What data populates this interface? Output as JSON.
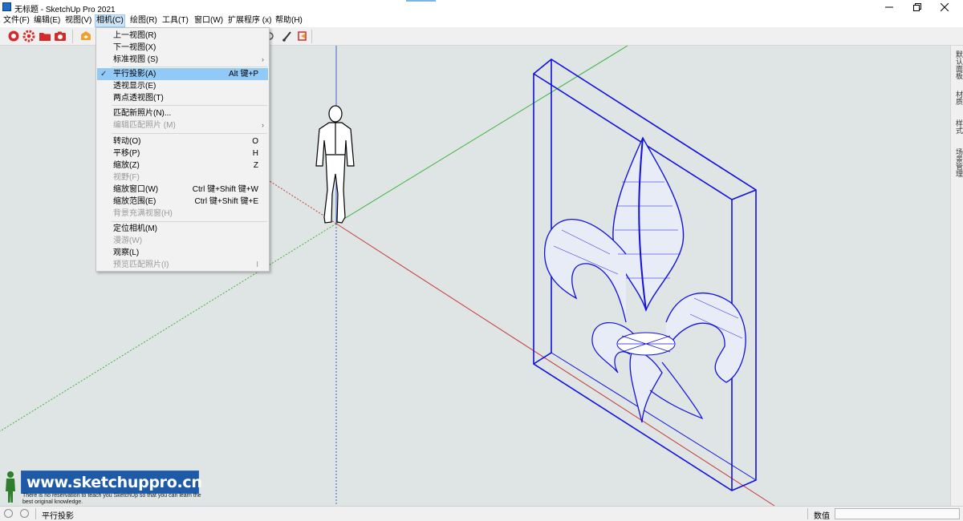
{
  "window": {
    "title": "无标题 - SketchUp Pro 2021"
  },
  "menubar": {
    "items": [
      {
        "label": "文件(F)"
      },
      {
        "label": "编辑(E)"
      },
      {
        "label": "视图(V)"
      },
      {
        "label": "相机(C)"
      },
      {
        "label": "绘图(R)"
      },
      {
        "label": "工具(T)"
      },
      {
        "label": "窗口(W)"
      },
      {
        "label": "扩展程序 (x)"
      },
      {
        "label": "帮助(H)"
      }
    ]
  },
  "camera_menu": {
    "items": [
      {
        "label": "上一视图(R)",
        "shortcut": ""
      },
      {
        "label": "下一视图(X)",
        "shortcut": ""
      },
      {
        "label": "标准视图 (S)",
        "shortcut": ""
      },
      {
        "label": "平行投影(A)",
        "shortcut": "Alt 键+P"
      },
      {
        "label": "透视显示(E)",
        "shortcut": ""
      },
      {
        "label": "两点透视图(T)",
        "shortcut": ""
      },
      {
        "label": "匹配新照片(N)...",
        "shortcut": ""
      },
      {
        "label": "编辑匹配照片 (M)",
        "shortcut": ""
      },
      {
        "label": "转动(O)",
        "shortcut": "O"
      },
      {
        "label": "平移(P)",
        "shortcut": "H"
      },
      {
        "label": "缩放(Z)",
        "shortcut": "Z"
      },
      {
        "label": "视野(F)",
        "shortcut": ""
      },
      {
        "label": "缩放窗口(W)",
        "shortcut": "Ctrl 键+Shift 键+W"
      },
      {
        "label": "缩放范围(E)",
        "shortcut": "Ctrl 键+Shift 键+E"
      },
      {
        "label": "背景充满视窗(H)",
        "shortcut": ""
      },
      {
        "label": "定位相机(M)",
        "shortcut": ""
      },
      {
        "label": "漫游(W)",
        "shortcut": ""
      },
      {
        "label": "观察(L)",
        "shortcut": ""
      },
      {
        "label": "预览匹配照片(I)",
        "shortcut": "I"
      }
    ],
    "checkmark": "✓"
  },
  "right_tray": {
    "tabs": [
      {
        "label": "默认面板"
      },
      {
        "label": "材质"
      },
      {
        "label": "样式"
      },
      {
        "label": "场景管理"
      }
    ]
  },
  "watermark": {
    "title": "www.sketchuppro.cn",
    "subtitle": "There is no reservation to teach you SketchUp so that you can learn the best original knowledge."
  },
  "statusbar": {
    "text": "平行投影",
    "measure_label": "数值"
  },
  "colors": {
    "model_edges": "#1010e0",
    "menu_highlight": "#91c9f7",
    "axis_red": "#c83c3c",
    "axis_green": "#3cb43c",
    "axis_blue": "#3c64d2"
  }
}
